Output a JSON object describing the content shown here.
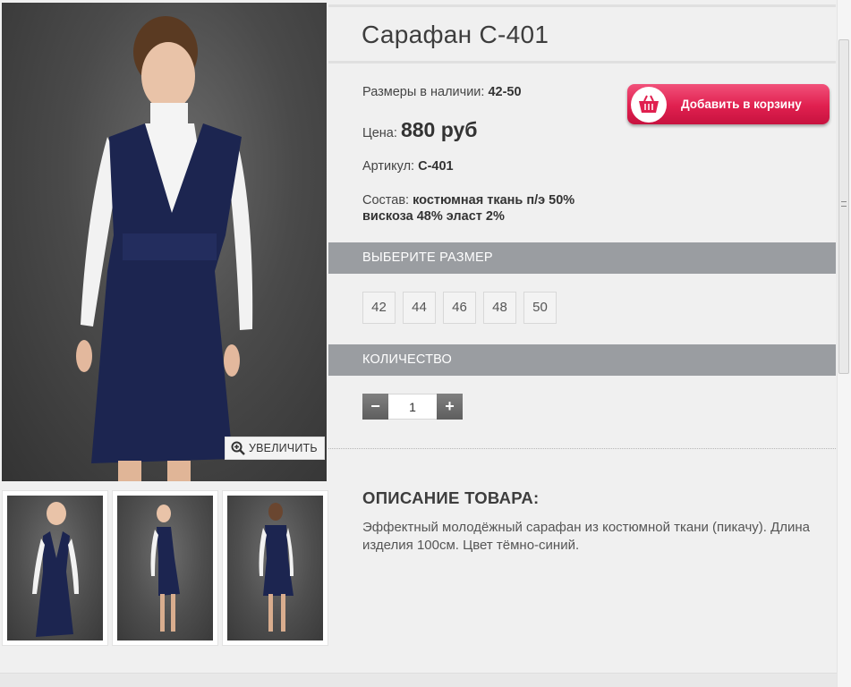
{
  "product": {
    "title": "Сарафан С-401",
    "sizes_label": "Размеры в наличии:",
    "sizes_value": "42-50",
    "price_label": "Цена:",
    "price_value": "880 руб",
    "article_label": "Артикул:",
    "article_value": "С-401",
    "composition_label": "Состав:",
    "composition_line1": "костюмная ткань п/э 50%",
    "composition_line2": "вискоза 48% эласт 2%"
  },
  "cart_button": {
    "label": "Добавить в корзину",
    "icon": "basket-icon",
    "color": "#e0204f"
  },
  "zoom": {
    "label": "УВЕЛИЧИТЬ",
    "icon": "zoom-in-icon"
  },
  "size_section": {
    "title": "ВЫБЕРИТЕ РАЗМЕР",
    "options": [
      "42",
      "44",
      "46",
      "48",
      "50"
    ]
  },
  "quantity_section": {
    "title": "КОЛИЧЕСТВО",
    "minus": "−",
    "plus": "+",
    "value": "1"
  },
  "description": {
    "title": "ОПИСАНИЕ ТОВАРА:",
    "text": "Эффектный молодёжный сарафан из костюмной ткани (пикачу). Длина изделия 100см. Цвет тёмно-синий."
  },
  "colors": {
    "section_bar": "#9a9da1",
    "dress": "#1c2550"
  }
}
